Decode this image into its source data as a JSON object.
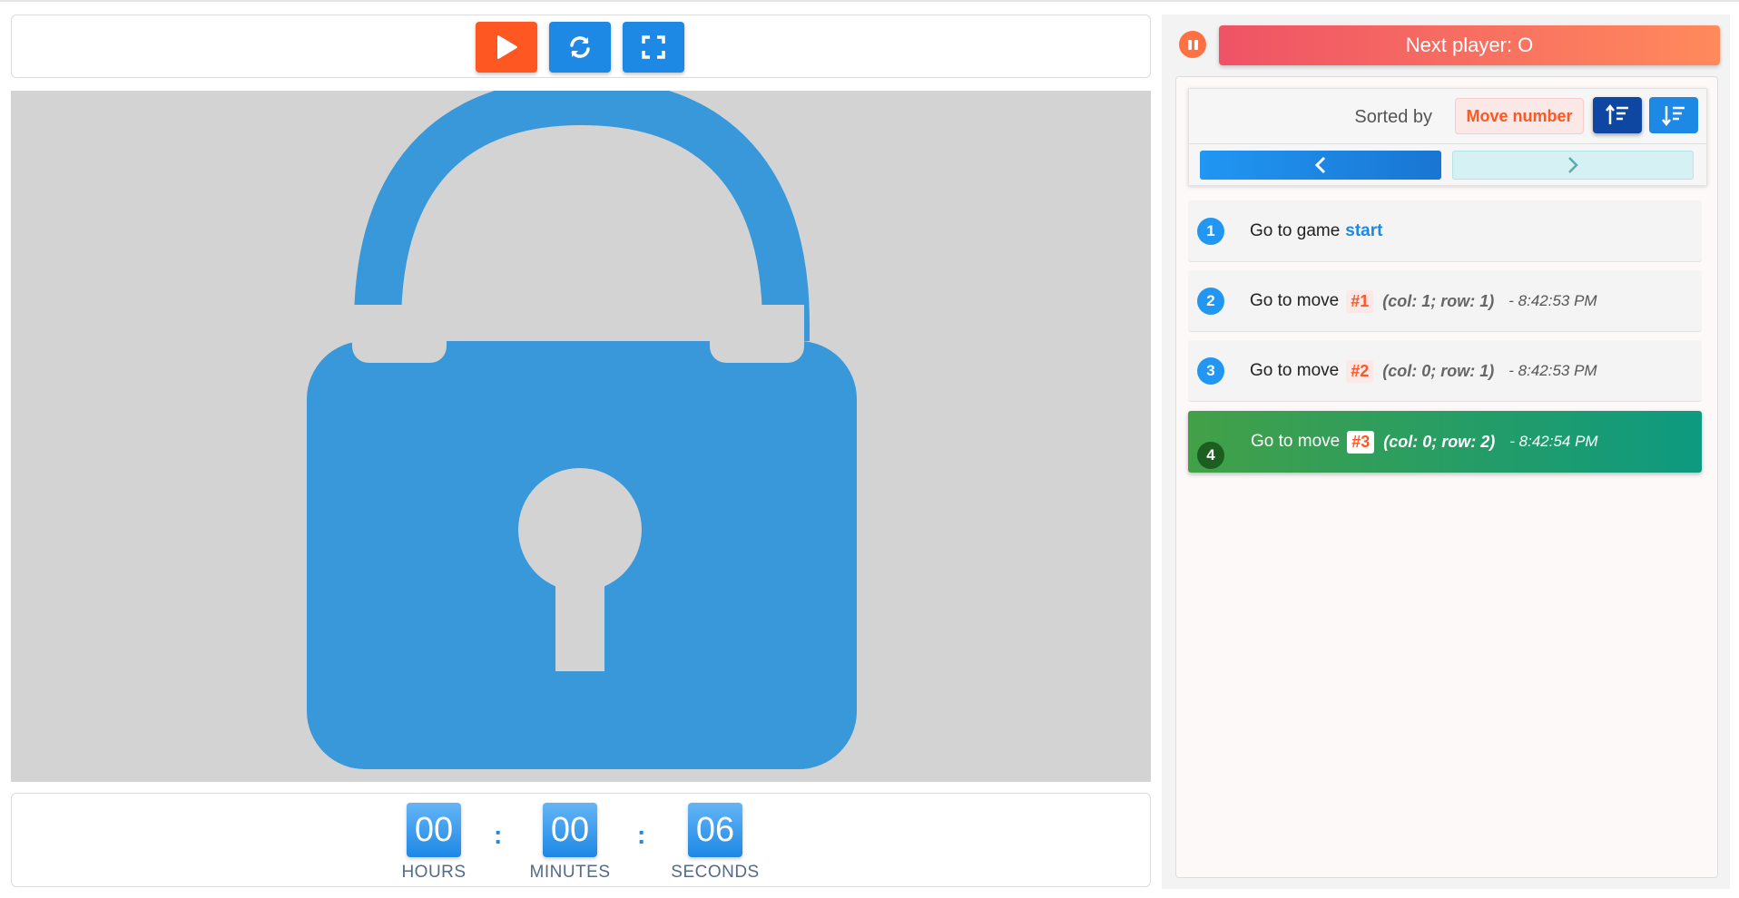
{
  "toolbar": {
    "play_icon": "play-icon",
    "restart_icon": "refresh-icon",
    "fullscreen_icon": "fullscreen-icon",
    "accent_color": "#ff5722",
    "primary_color": "#1e88e5"
  },
  "board": {
    "state": "locked",
    "icon": "lock-icon",
    "lock_color": "#3898da",
    "background_color": "#d3d3d3"
  },
  "timer": {
    "hours": "00",
    "minutes": "00",
    "seconds": "06",
    "hours_label": "HOURS",
    "minutes_label": "MINUTES",
    "seconds_label": "SECONDS",
    "separator": ":"
  },
  "status": {
    "pause_icon": "pause-icon",
    "next_player": "Next player: O"
  },
  "history": {
    "sorted_by_label": "Sorted by",
    "sort_key": "Move number",
    "sort_asc_icon": "sort-ascending-icon",
    "sort_desc_icon": "sort-descending-icon",
    "prev_icon": "chevron-left-icon",
    "next_icon": "chevron-right-icon",
    "moves": [
      {
        "num": "1",
        "text": "Go to game",
        "link": "start"
      },
      {
        "num": "2",
        "text": "Go to move",
        "tag": "#1",
        "coords": "(col: 1; row: 1)",
        "time": "- 8:42:53 PM"
      },
      {
        "num": "3",
        "text": "Go to move",
        "tag": "#2",
        "coords": "(col: 0; row: 1)",
        "time": "- 8:42:53 PM"
      },
      {
        "num": "4",
        "text": "Go to move",
        "tag": "#3",
        "coords": "(col: 0; row: 2)",
        "time": "- 8:42:54 PM",
        "active": true
      }
    ]
  }
}
